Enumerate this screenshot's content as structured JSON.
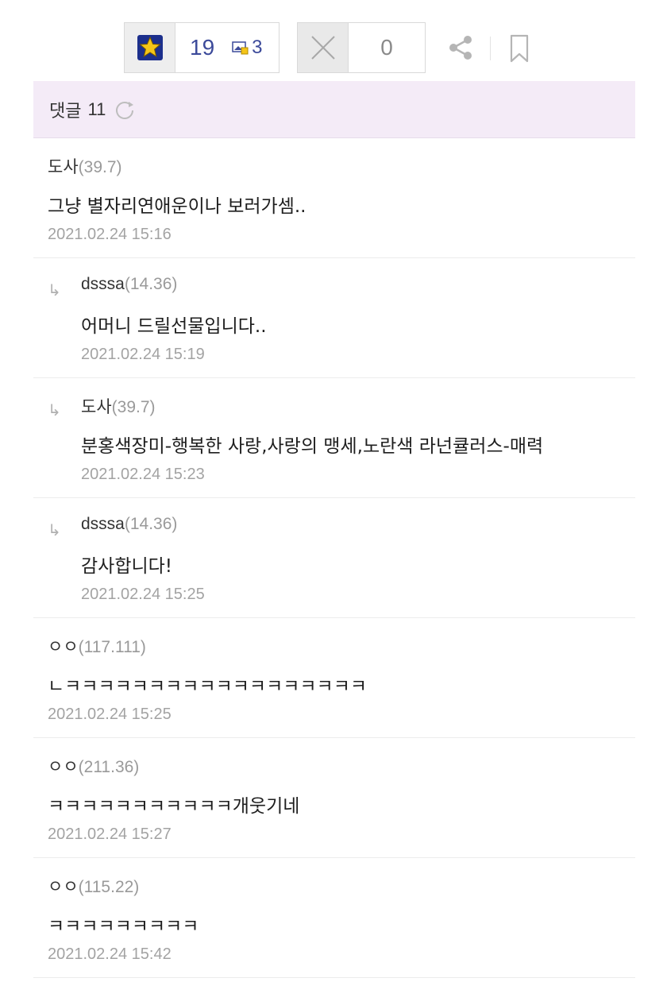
{
  "recommend": {
    "count": "19",
    "fix_count": "3",
    "star_color": "#f5c518",
    "count_color": "#3c4a9a"
  },
  "nonrecommend": {
    "count": "0"
  },
  "comment_header": {
    "label": "댓글",
    "count": "11",
    "background": "#f4ebf7"
  },
  "comments": [
    {
      "type": "top",
      "nick": "도사",
      "ip": "(39.7)",
      "text": "그냥 별자리연애운이나 보러가셈..",
      "date": "2021.02.24 15:16"
    },
    {
      "type": "reply",
      "nick": "dsssa",
      "ip": "(14.36)",
      "text": "어머니 드릴선물입니다..",
      "date": "2021.02.24 15:19"
    },
    {
      "type": "reply",
      "nick": "도사",
      "ip": "(39.7)",
      "text": "분홍색장미-행복한 사랑,사랑의 맹세,노란색 라넌큘러스-매력",
      "date": "2021.02.24 15:23"
    },
    {
      "type": "reply",
      "nick": "dsssa",
      "ip": "(14.36)",
      "text": "감사합니다!",
      "date": "2021.02.24 15:25"
    },
    {
      "type": "top",
      "nick": "ㅇㅇ",
      "ip": "(117.111)",
      "text": "ㄴㅋㅋㅋㅋㅋㅋㅋㅋㅋㅋㅋㅋㅋㅋㅋㅋㅋㅋ",
      "date": "2021.02.24 15:25"
    },
    {
      "type": "top",
      "nick": "ㅇㅇ",
      "ip": "(211.36)",
      "text": "ㅋㅋㅋㅋㅋㅋㅋㅋㅋㅋㅋ개웃기네",
      "date": "2021.02.24 15:27"
    },
    {
      "type": "top",
      "nick": "ㅇㅇ",
      "ip": "(115.22)",
      "text": "ㅋㅋㅋㅋㅋㅋㅋㅋㅋ",
      "date": "2021.02.24 15:42"
    }
  ],
  "icons": {
    "recommend": "star-icon",
    "fix": "image-fix-icon",
    "nonrecommend": "x-icon",
    "share": "share-icon",
    "bookmark": "bookmark-icon",
    "refresh": "refresh-icon",
    "reply": "reply-arrow-icon"
  },
  "reply_arrow": "↳"
}
